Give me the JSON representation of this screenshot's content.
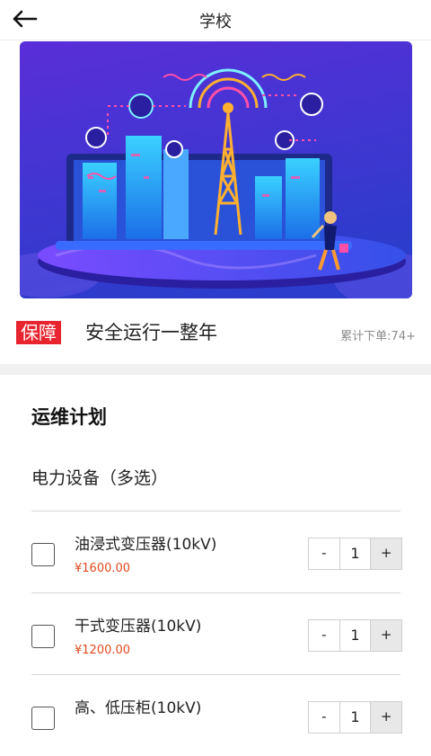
{
  "header": {
    "title": "学校",
    "back_icon": "arrow-left-icon"
  },
  "banner": {
    "pages": 1,
    "active_page": 1
  },
  "guarantee": {
    "tag": "保障",
    "slogan": "安全运行一整年",
    "orders": "累计下单:74+"
  },
  "section": {
    "title": "运维计划",
    "subtitle": "电力设备（多选）"
  },
  "items": [
    {
      "name": "油浸式变压器(10kV)",
      "price": "¥1600.00",
      "qty": "1",
      "minus": "-",
      "plus": "+"
    },
    {
      "name": "干式变压器(10kV)",
      "price": "¥1200.00",
      "qty": "1",
      "minus": "-",
      "plus": "+"
    },
    {
      "name": "高、低压柜(10kV)",
      "price": "",
      "qty": "1",
      "minus": "-",
      "plus": "+"
    }
  ],
  "colors": {
    "accent_red": "#e8242f",
    "price": "#e04a1e",
    "banner_start": "#5b2bd6",
    "banner_end": "#2f3fd0"
  }
}
